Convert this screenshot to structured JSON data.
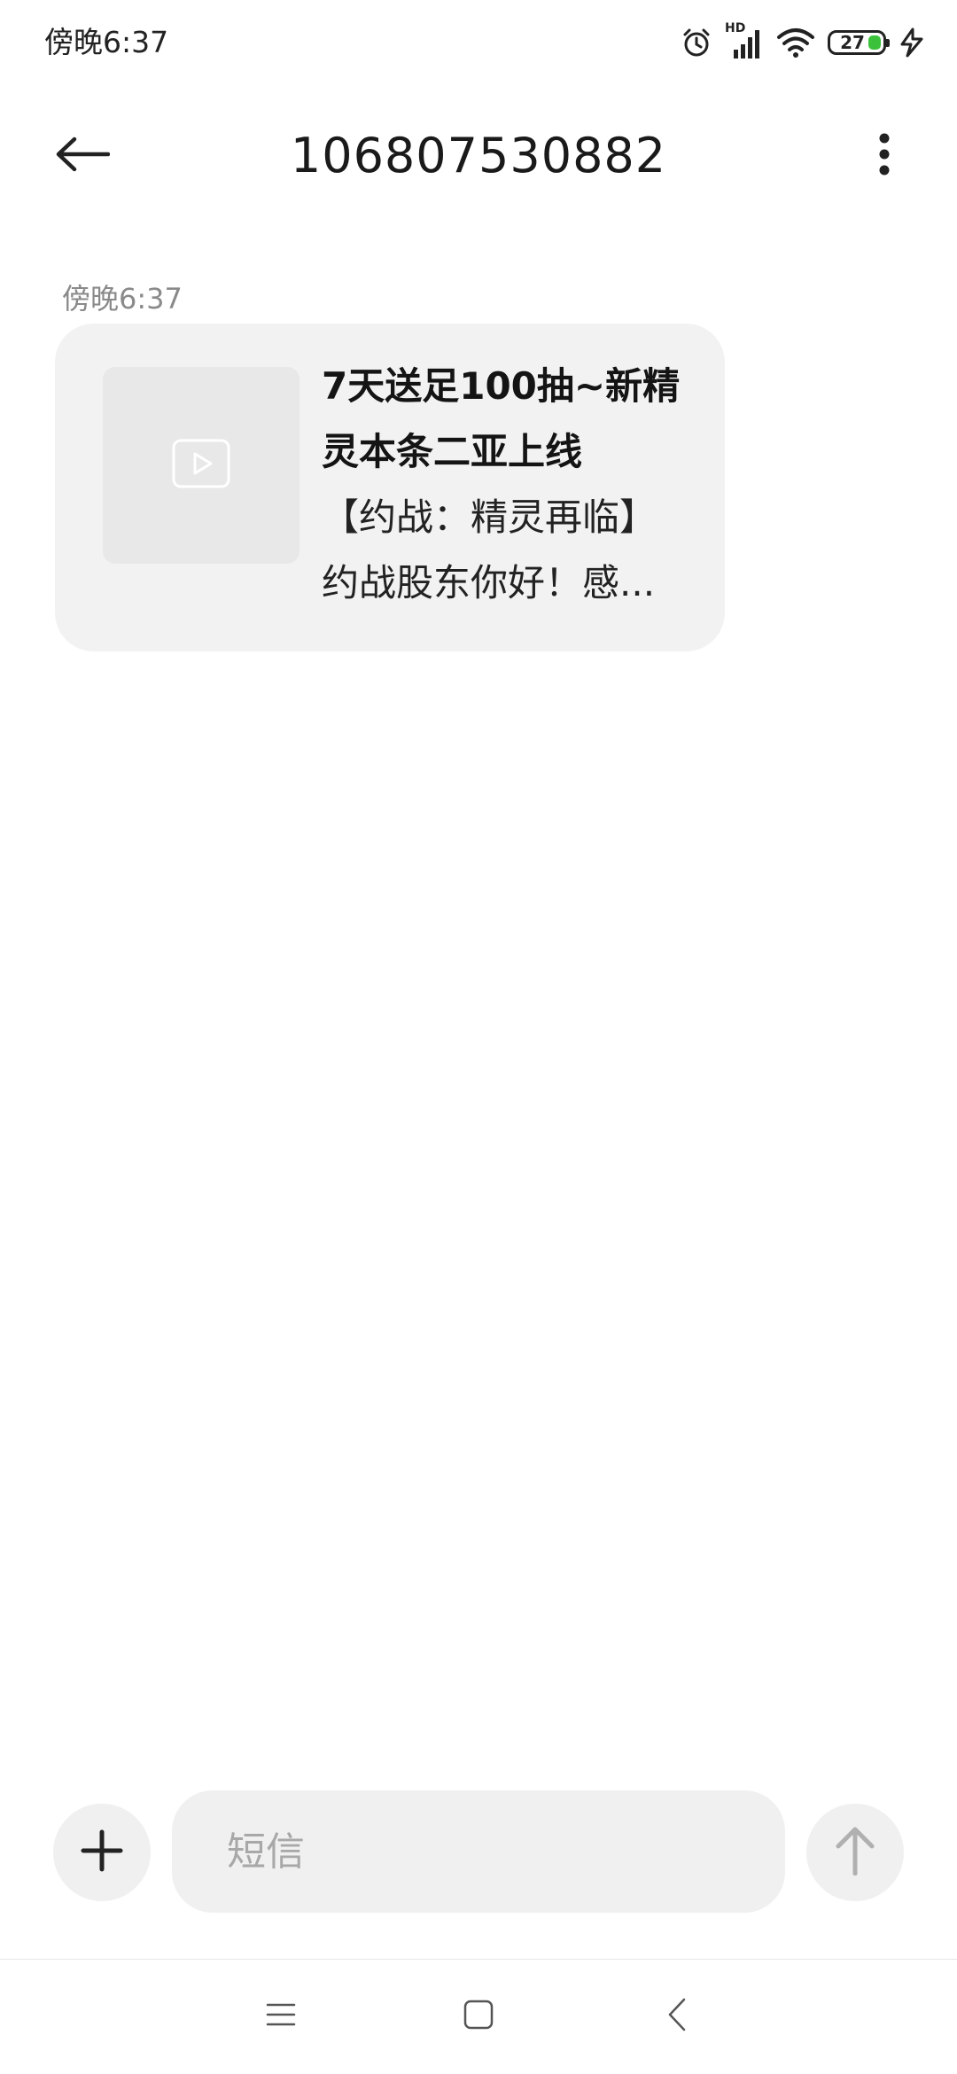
{
  "status_bar": {
    "time": "傍晚6:37",
    "battery_level": "27",
    "icons": [
      "alarm-icon",
      "hd-signal-icon",
      "wifi-icon",
      "battery-icon",
      "charging-icon"
    ],
    "signal_label": "HD"
  },
  "header": {
    "title": "106807530882",
    "back_icon": "back-arrow-icon",
    "more_icon": "more-vertical-icon"
  },
  "conversation": {
    "messages": [
      {
        "time": "傍晚6:37",
        "type": "rich-card",
        "thumbnail_icon": "video-play-icon",
        "title": "7天送足100抽~新精灵本条二亚上线",
        "body": "【约战：精灵再临】约战股东你好！感..."
      }
    ]
  },
  "composer": {
    "placeholder": "短信",
    "value": "",
    "attach_icon": "plus-icon",
    "send_icon": "arrow-up-icon"
  },
  "nav_bar": {
    "items": [
      "menu-icon",
      "home-square-icon",
      "back-chevron-icon"
    ]
  },
  "colors": {
    "bubble_background": "#f2f2f2",
    "input_background": "#f0f0f0",
    "timestamp": "#8a8a8a",
    "battery_fill": "#3cc13b"
  }
}
